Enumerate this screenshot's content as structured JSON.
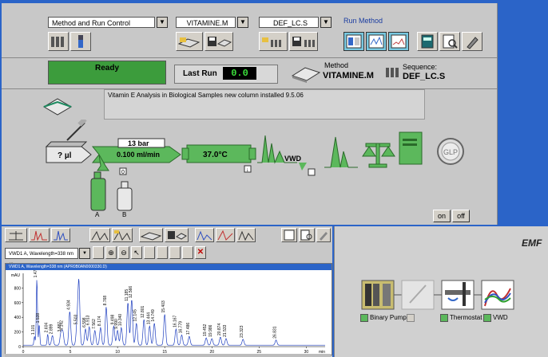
{
  "top_window": {
    "dropdowns": [
      {
        "value": "Method and Run Control"
      },
      {
        "value": "VITAMINE.M"
      },
      {
        "value": "DEF_LC.S"
      }
    ],
    "run_method_label": "Run Method",
    "status": {
      "state": "Ready",
      "last_run_label": "Last Run",
      "last_run_value": "0.0",
      "method_label": "Method",
      "method_value": "VITAMINE.M",
      "sequence_label": "Sequence:",
      "sequence_value": "DEF_LC.S"
    },
    "comment": "Vitamin E Analysis in Biological Samples new column installed 9.5.06",
    "diagram": {
      "injection": "? µl",
      "pressure": "13 bar",
      "flow": "0.100 ml/min",
      "temperature": "37.0°C",
      "detector": "VWD",
      "bottle_a": "A",
      "bottle_b": "B",
      "glp": "GLP",
      "on_label": "on",
      "off_label": "off"
    }
  },
  "chrom_window": {
    "signal_select": "VWD1 A, Wavelength=338 nm (A",
    "chart_title": "VWD1 A, Wavelength=338 nm (APR0B0AN0000330.D)",
    "y_unit": "mAU",
    "x_unit": "min"
  },
  "status_panel": {
    "logo": "EMF",
    "modules": [
      {
        "name": "Binary Pump",
        "status_color": "#5cb85c"
      },
      {
        "name": "",
        "status_color": "#d4d0c8"
      },
      {
        "name": "Thermostat",
        "status_color": "#5cb85c"
      },
      {
        "name": "VWD",
        "status_color": "#5cb85c"
      }
    ]
  },
  "chart_data": {
    "type": "line",
    "title": "VWD1 A, Wavelength=338 nm (APR0B0AN0000330.D)",
    "xlabel": "min",
    "ylabel": "mAU",
    "xlim": [
      0,
      32
    ],
    "ylim": [
      0,
      1000
    ],
    "xticks": [
      0,
      5,
      10,
      15,
      20,
      25,
      30
    ],
    "yticks": [
      0,
      200,
      400,
      600,
      800
    ],
    "peaks": [
      {
        "x": 1.2,
        "y": 120,
        "label": "1.101"
      },
      {
        "x": 1.45,
        "y": 900,
        "label": "1.479"
      },
      {
        "x": 1.7,
        "y": 280,
        "label": "1.538"
      },
      {
        "x": 2.6,
        "y": 150,
        "label": "2.604"
      },
      {
        "x": 3.1,
        "y": 130,
        "label": "2.899"
      },
      {
        "x": 4.0,
        "y": 160,
        "label": "3.887"
      },
      {
        "x": 4.2,
        "y": 180,
        "label": "4.142"
      },
      {
        "x": 4.94,
        "y": 460,
        "label": "4.934"
      },
      {
        "x": 5.7,
        "y": 260,
        "label": "5.503"
      },
      {
        "x": 5.9,
        "y": 870,
        "label": ""
      },
      {
        "x": 6.6,
        "y": 220,
        "label": "6.598"
      },
      {
        "x": 7.0,
        "y": 250,
        "label": "6.913"
      },
      {
        "x": 7.6,
        "y": 200,
        "label": "7.562"
      },
      {
        "x": 8.2,
        "y": 240,
        "label": "8.174"
      },
      {
        "x": 8.8,
        "y": 520,
        "label": "8.768"
      },
      {
        "x": 9.6,
        "y": 260,
        "label": "9.498"
      },
      {
        "x": 10.0,
        "y": 200,
        "label": "9.990"
      },
      {
        "x": 10.4,
        "y": 240,
        "label": "10.340"
      },
      {
        "x": 11.1,
        "y": 580,
        "label": "11.185"
      },
      {
        "x": 11.5,
        "y": 620,
        "label": "12.566"
      },
      {
        "x": 12.0,
        "y": 300,
        "label": "12.145"
      },
      {
        "x": 12.8,
        "y": 350,
        "label": "12.801"
      },
      {
        "x": 13.4,
        "y": 260,
        "label": "13.444"
      },
      {
        "x": 13.9,
        "y": 300,
        "label": "14.749"
      },
      {
        "x": 15.0,
        "y": 420,
        "label": "15.403"
      },
      {
        "x": 16.2,
        "y": 220,
        "label": "16.167"
      },
      {
        "x": 16.8,
        "y": 140,
        "label": "16.779"
      },
      {
        "x": 17.6,
        "y": 120,
        "label": "17.486"
      },
      {
        "x": 19.4,
        "y": 100,
        "label": "19.452"
      },
      {
        "x": 20.0,
        "y": 90,
        "label": "19.986"
      },
      {
        "x": 20.9,
        "y": 110,
        "label": "20.874"
      },
      {
        "x": 21.5,
        "y": 90,
        "label": "21.533"
      },
      {
        "x": 23.3,
        "y": 80,
        "label": "23.323"
      },
      {
        "x": 26.8,
        "y": 70,
        "label": "26.831"
      }
    ]
  }
}
